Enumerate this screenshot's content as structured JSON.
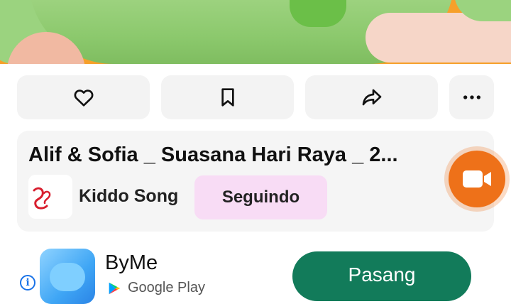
{
  "actions": {
    "like_icon": "heart-icon",
    "save_icon": "bookmark-icon",
    "share_icon": "share-icon",
    "more_icon": "more-icon"
  },
  "video": {
    "title": "Alif & Sofia _ Suasana Hari Raya _ 2...",
    "channel": "Kiddo Song",
    "follow_label": "Seguindo"
  },
  "ad": {
    "app_name": "ByMe",
    "store": "Google Play",
    "install_label": "Pasang"
  },
  "colors": {
    "install": "#127b5a",
    "follow_bg": "#f8dcf5",
    "fab": "#ee7119"
  }
}
